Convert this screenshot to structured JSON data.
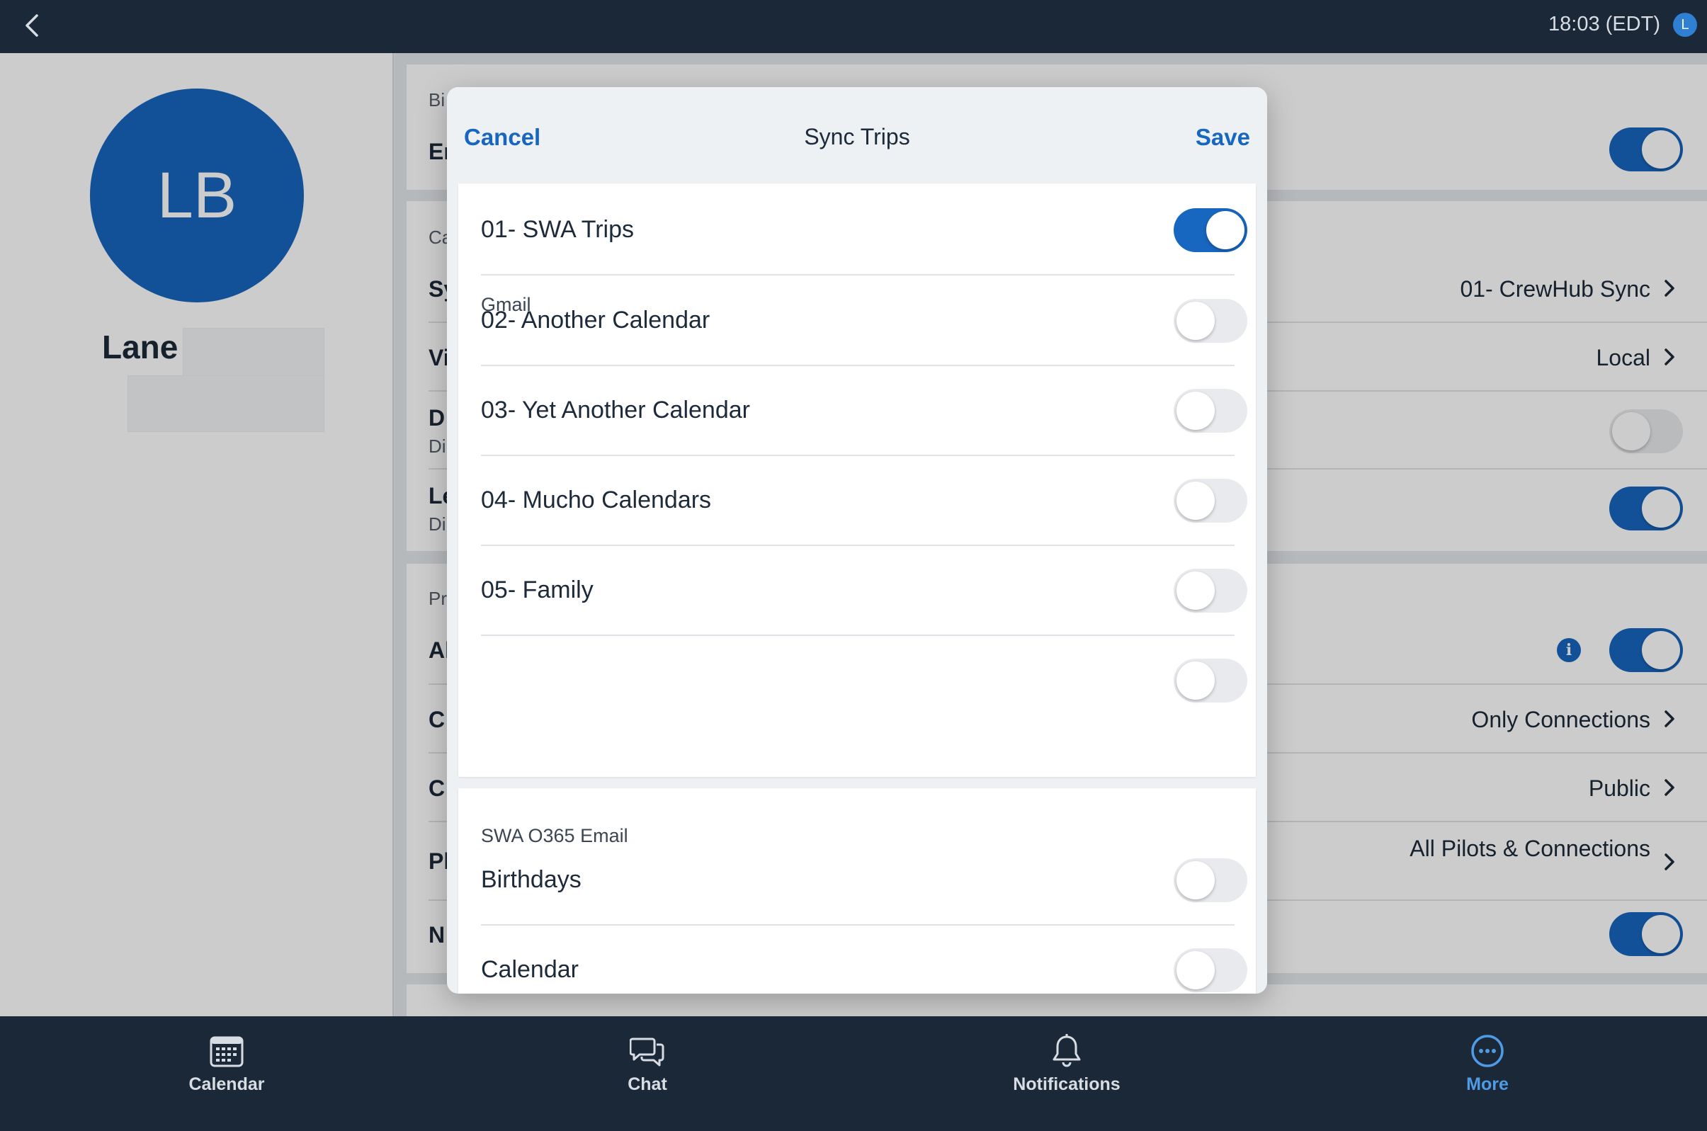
{
  "topbar": {
    "time": "18:03 (EDT)",
    "avatar_initial": "L"
  },
  "profile": {
    "initials": "LB",
    "name": "Lane"
  },
  "background": {
    "card1": {
      "label": "Bi",
      "row": "Er"
    },
    "card2": {
      "label": "Ca",
      "rows": [
        {
          "label": "Sy",
          "value": "01-  CrewHub Sync"
        },
        {
          "label": "Vi",
          "value": "Local"
        },
        {
          "label": "D",
          "sub": "Di"
        },
        {
          "label": "Le",
          "sub": "Di"
        }
      ]
    },
    "card3": {
      "label": "Pr",
      "rows": [
        {
          "label": "Al"
        },
        {
          "label": "C",
          "value": "Only Connections"
        },
        {
          "label": "C",
          "value": "Public"
        },
        {
          "label": "Pl",
          "value": "All Pilots & Connections"
        },
        {
          "label": "N"
        }
      ]
    }
  },
  "modal": {
    "cancel_label": "Cancel",
    "title": "Sync Trips",
    "save_label": "Save",
    "groups": [
      {
        "title": "Gmail",
        "items": [
          {
            "label": "01-  SWA Trips",
            "enabled": true
          },
          {
            "label": "02- Another Calendar",
            "enabled": false
          },
          {
            "label": "03- Yet Another Calendar",
            "enabled": false
          },
          {
            "label": "04- Mucho Calendars",
            "enabled": false
          },
          {
            "label": "05- Family",
            "enabled": false
          },
          {
            "label": "",
            "enabled": false
          }
        ]
      },
      {
        "title": "SWA O365 Email",
        "items": [
          {
            "label": "Birthdays",
            "enabled": false
          },
          {
            "label": "Calendar",
            "enabled": false
          }
        ]
      }
    ]
  },
  "tabs": [
    {
      "label": "Calendar",
      "icon": "calendar-icon",
      "active": false
    },
    {
      "label": "Chat",
      "icon": "chat-icon",
      "active": false
    },
    {
      "label": "Notifications",
      "icon": "bell-icon",
      "active": false
    },
    {
      "label": "More",
      "icon": "more-icon",
      "active": true
    }
  ],
  "colors": {
    "accent": "#1766bf",
    "bar": "#1a2838",
    "active_tab": "#4f9be6"
  }
}
